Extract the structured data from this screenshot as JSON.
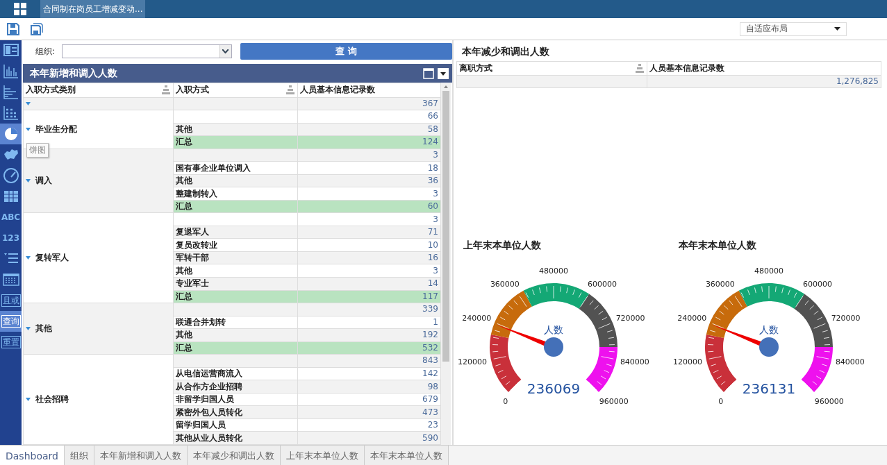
{
  "app_bar": {
    "tab": "合同制在岗员工增减变动..."
  },
  "toolbar": {
    "layout_select": "自适应布局"
  },
  "sidebar": {
    "items": [
      {
        "kind": "icon",
        "selected": false
      },
      {
        "kind": "icon",
        "selected": false
      },
      {
        "kind": "icon",
        "selected": false
      },
      {
        "kind": "icon",
        "selected": false
      },
      {
        "kind": "icon",
        "selected": true
      },
      {
        "kind": "icon",
        "selected": false
      },
      {
        "kind": "icon",
        "selected": false
      },
      {
        "kind": "icon",
        "selected": false
      },
      {
        "kind": "text",
        "text": "ABC",
        "selected": false
      },
      {
        "kind": "text",
        "text": "123",
        "selected": false
      },
      {
        "kind": "icon",
        "selected": false
      },
      {
        "kind": "icon",
        "selected": false
      },
      {
        "kind": "boxed",
        "text": "且或",
        "selected": false
      },
      {
        "kind": "boxed",
        "text": "查询",
        "selected": true
      },
      {
        "kind": "boxed",
        "text": "重置",
        "selected": false
      }
    ],
    "tooltip": "饼图"
  },
  "filter": {
    "label": "组织:",
    "button": "查 询"
  },
  "left_table": {
    "title": "本年新增和调入人数",
    "columns": [
      "入职方式类别",
      "入职方式",
      "人员基本信息记录数"
    ],
    "groups": [
      {
        "expanded": true,
        "rows": [
          {
            "kind": "item",
            "value": "367"
          }
        ]
      },
      {
        "label": "毕业生分配",
        "expanded": true,
        "rows": [
          {
            "kind": "item",
            "value": "66"
          },
          {
            "kind": "item",
            "label": "其他",
            "value": "58"
          },
          {
            "kind": "total",
            "label": "汇总",
            "value": "124"
          }
        ]
      },
      {
        "label": "调入",
        "expanded": true,
        "rows": [
          {
            "kind": "item",
            "value": "3"
          },
          {
            "kind": "item",
            "label": "国有事企业单位调入",
            "value": "18"
          },
          {
            "kind": "item",
            "label": "其他",
            "value": "36"
          },
          {
            "kind": "item",
            "label": "整建制转入",
            "value": "3"
          },
          {
            "kind": "total",
            "label": "汇总",
            "value": "60"
          }
        ]
      },
      {
        "label": "复转军人",
        "expanded": true,
        "rows": [
          {
            "kind": "item",
            "value": "3"
          },
          {
            "kind": "item",
            "label": "复退军人",
            "value": "71"
          },
          {
            "kind": "item",
            "label": "复员改转业",
            "value": "10"
          },
          {
            "kind": "item",
            "label": "军转干部",
            "value": "16"
          },
          {
            "kind": "item",
            "label": "其他",
            "value": "3"
          },
          {
            "kind": "item",
            "label": "专业军士",
            "value": "14"
          },
          {
            "kind": "total",
            "label": "汇总",
            "value": "117"
          }
        ]
      },
      {
        "label": "其他",
        "expanded": true,
        "rows": [
          {
            "kind": "item",
            "value": "339"
          },
          {
            "kind": "item",
            "label": "联通合并划转",
            "value": "1"
          },
          {
            "kind": "item",
            "label": "其他",
            "value": "192"
          },
          {
            "kind": "total",
            "label": "汇总",
            "value": "532"
          }
        ]
      },
      {
        "label": "社会招聘",
        "expanded": true,
        "rows": [
          {
            "kind": "item",
            "value": "843"
          },
          {
            "kind": "item",
            "label": "从电信运营商流入",
            "value": "142"
          },
          {
            "kind": "item",
            "label": "从合作方企业招聘",
            "value": "98"
          },
          {
            "kind": "item",
            "label": "非留学归国人员",
            "value": "679"
          },
          {
            "kind": "item",
            "label": "紧密外包人员转化",
            "value": "473"
          },
          {
            "kind": "item",
            "label": "留学归国人员",
            "value": "23"
          },
          {
            "kind": "item",
            "label": "其他从业人员转化",
            "value": "590"
          }
        ]
      }
    ]
  },
  "right_table": {
    "title": "本年减少和调出人数",
    "columns": [
      "离职方式",
      "人员基本信息记录数"
    ],
    "rows": [
      {
        "cells": [
          "",
          "1,276,825"
        ]
      }
    ]
  },
  "gauges": [
    {
      "title": "上年末本单位人数",
      "label": "人数",
      "value": "236069",
      "level": 0.2459,
      "ticks": [
        "0",
        "120000",
        "240000",
        "360000",
        "480000",
        "600000",
        "720000",
        "840000",
        "960000"
      ]
    },
    {
      "title": "本年末本单位人数",
      "label": "人数",
      "value": "236131",
      "level": 0.246,
      "ticks": [
        "0",
        "120000",
        "240000",
        "360000",
        "480000",
        "600000",
        "720000",
        "840000",
        "960000"
      ]
    }
  ],
  "bottom_tabs": [
    {
      "label": "Dashboard",
      "selected": true
    },
    {
      "label": "组织",
      "selected": false
    },
    {
      "label": "本年新增和调入人数",
      "selected": false
    },
    {
      "label": "本年减少和调出人数",
      "selected": false
    },
    {
      "label": "上年末本单位人数",
      "selected": false
    },
    {
      "label": "本年末本单位人数",
      "selected": false
    }
  ]
}
